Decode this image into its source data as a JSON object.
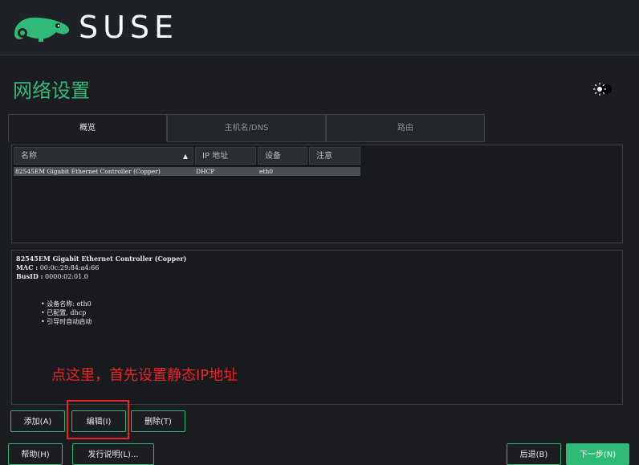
{
  "brand": {
    "name": "SUSE",
    "color": "#30ba78"
  },
  "page": {
    "title": "网络设置"
  },
  "tabs": [
    {
      "label": "概览",
      "active": true
    },
    {
      "label": "主机名/DNS",
      "active": false
    },
    {
      "label": "路由",
      "active": false
    }
  ],
  "table": {
    "columns": [
      "名称",
      "IP 地址",
      "设备",
      "注意"
    ],
    "sort_indicator": "▲",
    "rows": [
      {
        "name": "82545EM Gigabit Ethernet Controller (Copper)",
        "ip": "DHCP",
        "device": "eth0",
        "note": ""
      }
    ]
  },
  "details": {
    "title": "82545EM Gigabit Ethernet Controller (Copper)",
    "mac_label": "MAC :",
    "mac_value": "00:0c:29:84:a4:66",
    "busid_label": "BusID :",
    "busid_value": "0000:02:01.0",
    "bullets": [
      "• 设备名称: eth0",
      "• 已配置, dhcp",
      "• 引导时自动启动"
    ]
  },
  "annotation": {
    "text": "点这里，首先设置静态IP地址",
    "color": "#e8242a"
  },
  "buttons": {
    "add": "添加(A)",
    "edit": "编辑(I)",
    "delete": "删除(T)",
    "help": "帮助(H)",
    "release_notes": "发行说明(L)...",
    "back": "后退(B)",
    "next": "下一步(N)"
  },
  "icons": {
    "theme_toggle": "sun-toggle-icon",
    "logo": "chameleon-logo-icon"
  }
}
